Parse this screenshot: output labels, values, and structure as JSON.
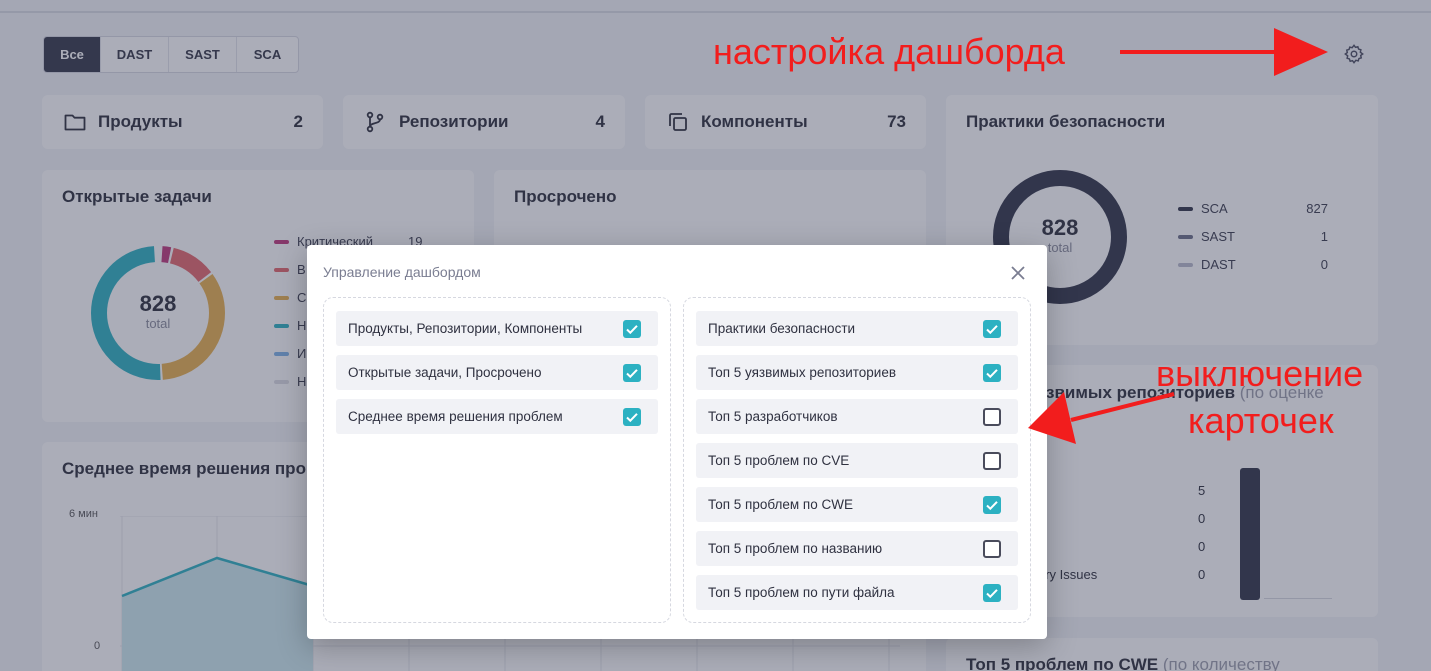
{
  "filter_tabs": [
    "Все",
    "DAST",
    "SAST",
    "SCA"
  ],
  "stats": {
    "products": {
      "label": "Продукты",
      "count": "2"
    },
    "repos": {
      "label": "Репозитории",
      "count": "4"
    },
    "components": {
      "label": "Компоненты",
      "count": "73"
    }
  },
  "open_tasks": {
    "title": "Открытые задачи",
    "total": "828",
    "total_label": "total",
    "legend": [
      {
        "label": "Критический",
        "value": "19",
        "color": "#c0377a"
      },
      {
        "label": "В",
        "value": "",
        "color": "#e5666c"
      },
      {
        "label": "С",
        "value": "",
        "color": "#e8b04d"
      },
      {
        "label": "Н",
        "value": "",
        "color": "#2cb1c2"
      },
      {
        "label": "И",
        "value": "",
        "color": "#7fb3e8"
      },
      {
        "label": "Н",
        "value": "",
        "color": "#dcdde3"
      }
    ]
  },
  "overdue": {
    "title": "Просрочено"
  },
  "practices": {
    "title": "Практики безопасности",
    "total": "828",
    "total_label": "total",
    "legend": [
      {
        "label": "SCA",
        "value": "827",
        "color": "#2f3246"
      },
      {
        "label": "SAST",
        "value": "1",
        "color": "#6c6f87"
      },
      {
        "label": "DAST",
        "value": "0",
        "color": "#b9bbcc"
      }
    ]
  },
  "avg_time": {
    "title": "Среднее время решения про",
    "y_top": "6 мин",
    "y_bottom": "0"
  },
  "top_repos": {
    "title_part": "звимых репозиториев",
    "sub": "(по оценке",
    "values": [
      "5",
      "0",
      "0",
      "0"
    ],
    "row_label": "ory Issues"
  },
  "top_cwe": {
    "title": "Топ 5 проблем по CWE",
    "sub": "(по количеству"
  },
  "modal": {
    "title": "Управление дашбордом",
    "left": [
      {
        "label": "Продукты, Репозитории, Компоненты",
        "checked": true
      },
      {
        "label": "Открытые задачи, Просрочено",
        "checked": true
      },
      {
        "label": "Среднее время решения проблем",
        "checked": true
      }
    ],
    "right": [
      {
        "label": "Практики безопасности",
        "checked": true
      },
      {
        "label": "Топ 5 уязвимых репозиториев",
        "checked": true
      },
      {
        "label": "Топ 5 разработчиков",
        "checked": false
      },
      {
        "label": "Топ 5 проблем по CVE",
        "checked": false
      },
      {
        "label": "Топ 5 проблем по CWE",
        "checked": true
      },
      {
        "label": "Топ 5 проблем по названию",
        "checked": false
      },
      {
        "label": "Топ 5 проблем по пути файла",
        "checked": true
      }
    ]
  },
  "annotations": {
    "settings": "настройка дашборда",
    "toggle_line1": "выключение",
    "toggle_line2": "карточек"
  },
  "colors": {
    "accent": "#2cb1c2",
    "annotation": "#f21d1d",
    "dark": "#323648"
  }
}
